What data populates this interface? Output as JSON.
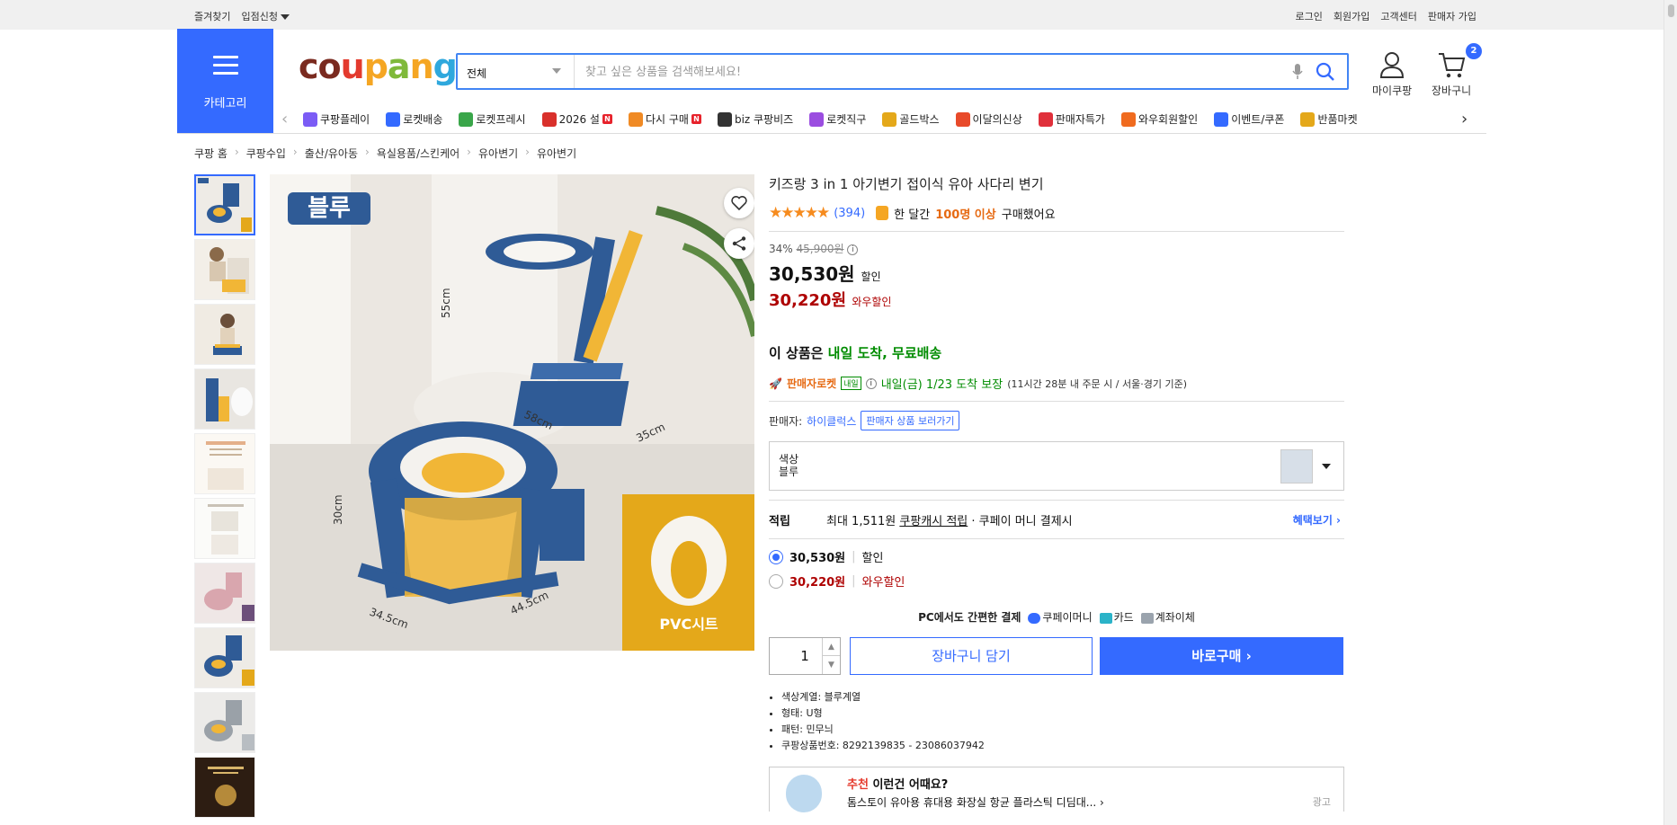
{
  "topbar": {
    "left": [
      "즐겨찾기",
      "입점신청"
    ],
    "right": [
      "로그인",
      "회원가입",
      "고객센터",
      "판매자 가입"
    ]
  },
  "header": {
    "category_label": "카테고리",
    "logo_text": "coupang",
    "search": {
      "category": "전체",
      "placeholder": "찾고 싶은 상품을 검색해보세요!"
    },
    "mypage_label": "마이쿠팡",
    "cart_label": "장바구니",
    "cart_count": "2"
  },
  "nav_items": [
    {
      "label": "쿠팡플레이",
      "color": "#7b5cf5"
    },
    {
      "label": "로켓배송",
      "color": "#346aff"
    },
    {
      "label": "로켓프레시",
      "color": "#3aa64a"
    },
    {
      "label": "2026 설",
      "color": "#d9302b",
      "badge": "N"
    },
    {
      "label": "다시 구매",
      "color": "#f08a24",
      "badge": "N"
    },
    {
      "label": "biz 쿠팡비즈",
      "color": "#333333"
    },
    {
      "label": "로켓직구",
      "color": "#9b4de0"
    },
    {
      "label": "골드박스",
      "color": "#e4a81a"
    },
    {
      "label": "이달의신상",
      "color": "#e84a2a"
    },
    {
      "label": "판매자특가",
      "color": "#e0303b"
    },
    {
      "label": "와우회원할인",
      "color": "#f06b1f"
    },
    {
      "label": "이벤트/쿠폰",
      "color": "#346aff"
    },
    {
      "label": "반품마켓",
      "color": "#e4a81a"
    }
  ],
  "breadcrumb": [
    "쿠팡 홈",
    "쿠팡수입",
    "출산/유아동",
    "욕실용품/스킨케어",
    "유아변기",
    "유아변기"
  ],
  "product": {
    "title": "키즈랑 3 in 1 아기변기 접이식 유아 사다리 변기",
    "stars": "★★★★★",
    "review_count": "(394)",
    "purchase_prefix": "한 달간",
    "purchase_highlight": "100명 이상",
    "purchase_suffix": "구매했어요",
    "discount_rate": "34%",
    "original_price": "45,900원",
    "price": "30,530원",
    "price_tag": "할인",
    "wow_price": "30,220원",
    "wow_tag": "와우할인",
    "delivery_prefix": "이 상품은",
    "delivery_highlight": "내일 도착, 무료배송",
    "rocket_label": "판매자로켓",
    "rocket_tag": "내일",
    "arrival": "내일(금) 1/23 도착 보장",
    "arrival_note": "(11시간 28분 내 주문 시 / 서울·경기 기준)",
    "seller_label": "판매자:",
    "seller_name": "하이클럭스",
    "seller_button": "판매자 상품 보러가기",
    "option_label": "색상",
    "option_value": "블루",
    "reward_label": "적립",
    "reward_prefix": "최대 1,511원",
    "reward_link": "쿠팡캐시 적립",
    "reward_suffix": "· 쿠페이 머니 결제시",
    "reward_more": "혜택보기",
    "radio_options": [
      {
        "price": "30,530원",
        "tag": "할인",
        "selected": true
      },
      {
        "price": "30,220원",
        "tag": "와우할인",
        "selected": false
      }
    ],
    "pay_title": "PC에서도 간편한 결제",
    "pay_methods": [
      "쿠페이머니",
      "카드",
      "계좌이체"
    ],
    "quantity": "1",
    "cart_button": "장바구니 담기",
    "buy_button": "바로구매",
    "specs": [
      "색상계열: 블루계열",
      "형태: U형",
      "패턴: 민무늬",
      "쿠팡상품번호: 8292139835 - 23086037942"
    ],
    "image": {
      "badge": "블루",
      "pvc_label": "PVC시트",
      "dims": [
        "55cm",
        "58cm",
        "35cm",
        "30cm",
        "34.5cm",
        "44.5cm"
      ]
    }
  },
  "recommend": {
    "title_highlight": "추천",
    "title_rest": "이런건 어때요?",
    "item": "톰스토이 유아용 휴대용 화장실 항균 플라스틱 디딤대...",
    "ad_label": "광고"
  },
  "colors": {
    "accent": "#346aff",
    "wow": "#ae0000",
    "green": "#008c00"
  }
}
